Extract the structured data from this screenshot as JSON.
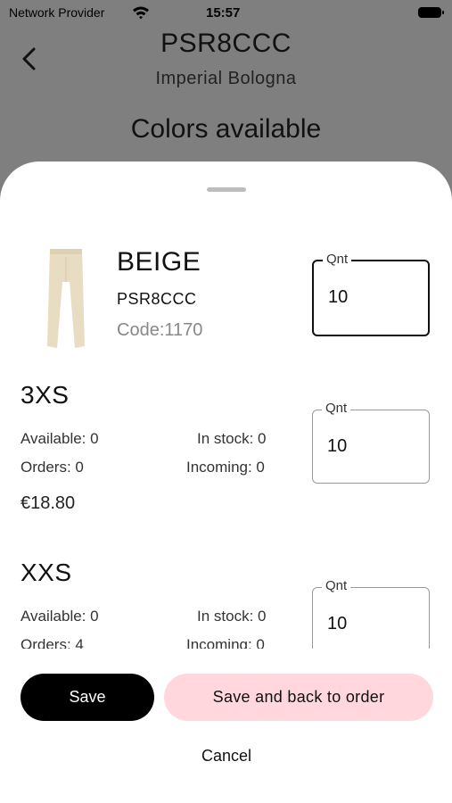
{
  "status_bar": {
    "carrier": "Network Provider",
    "time": "15:57"
  },
  "header": {
    "title": "PSR8CCC",
    "subtitle": "Imperial Bologna",
    "section_title": "Colors available"
  },
  "sheet": {
    "product": {
      "color_name": "BEIGE",
      "model_code": "PSR8CCC",
      "item_code": "Code:1170",
      "qty_label": "Qnt",
      "qty_value": "10"
    },
    "sizes": [
      {
        "size": "3XS",
        "available": "Available: 0",
        "in_stock": "In stock: 0",
        "orders": "Orders: 0",
        "incoming": "Incoming: 0",
        "price": "€18.80",
        "qty_label": "Qnt",
        "qty_value": "10"
      },
      {
        "size": "XXS",
        "available": "Available: 0",
        "in_stock": "In stock: 0",
        "orders": "Orders: 4",
        "incoming": "Incoming: 0",
        "qty_label": "Qnt",
        "qty_value": "10"
      }
    ],
    "buttons": {
      "save": "Save",
      "save_and_back": "Save and back to order",
      "cancel": "Cancel"
    }
  },
  "colors": {
    "primary_button": "#000000",
    "secondary_button": "#ffd7dc",
    "overlay": "#7f7f7f",
    "product_beige": "#e8dcc2"
  }
}
